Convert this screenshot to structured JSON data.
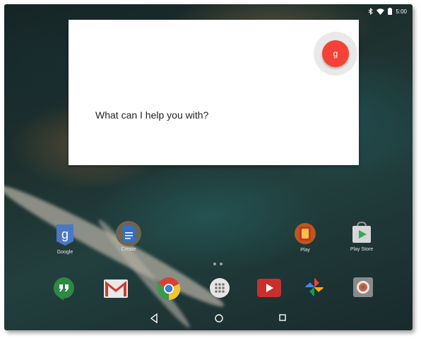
{
  "status_bar": {
    "time": "5:00",
    "icons": [
      "bluetooth-icon",
      "wifi-icon",
      "battery-icon"
    ]
  },
  "assistant": {
    "prompt": "What can I help you with?",
    "mic_glyph": "g",
    "accent_color": "#f44336"
  },
  "home": {
    "apps": [
      {
        "label": "Google",
        "icon": "google-search-icon"
      },
      {
        "label": "Create",
        "icon": "google-docs-icon"
      },
      {
        "label": "Play",
        "icon": "play-folder-icon"
      },
      {
        "label": "Play Store",
        "icon": "play-store-icon"
      }
    ],
    "dock": [
      {
        "icon": "hangouts-icon"
      },
      {
        "icon": "gmail-icon"
      },
      {
        "icon": "chrome-icon"
      },
      {
        "icon": "app-drawer-icon"
      },
      {
        "icon": "youtube-icon"
      },
      {
        "icon": "photos-icon"
      },
      {
        "icon": "camera-icon"
      }
    ],
    "page_indicator": {
      "pages": 2,
      "current": 1
    }
  },
  "nav_bar": {
    "buttons": [
      "back-icon",
      "home-icon",
      "recents-icon"
    ]
  }
}
